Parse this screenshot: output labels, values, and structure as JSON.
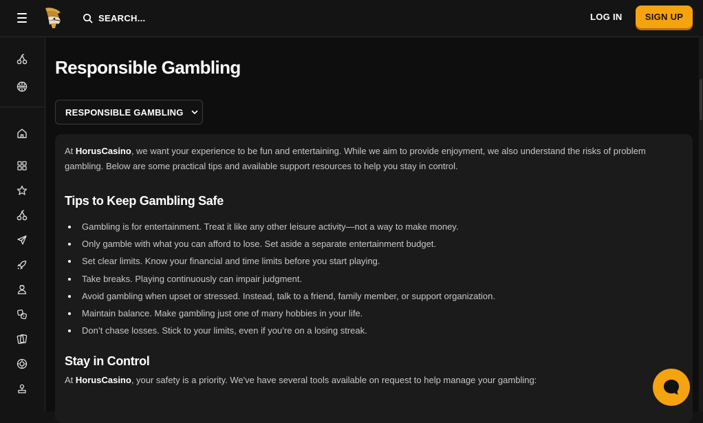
{
  "header": {
    "search_label": "SEARCH...",
    "login_label": "LOG IN",
    "signup_label": "SIGN UP",
    "accent_color": "#f5a30f"
  },
  "sidebar": {
    "icons": [
      "cherries-icon",
      "basketball-icon",
      "home-icon",
      "grid-icon",
      "star-icon",
      "cherries-icon",
      "plane-icon",
      "rocket-icon",
      "dealer-icon",
      "dice-icon",
      "cards-icon",
      "poker-chip-icon",
      "user-upload-icon"
    ]
  },
  "page": {
    "title": "Responsible Gambling",
    "dropdown_label": "RESPONSIBLE GAMBLING",
    "intro": {
      "prefix": "At ",
      "brand": "HorusCasino",
      "text": ", we want your experience to be fun and entertaining. While we aim to provide enjoyment, we also understand the risks of problem gambling. Below are some practical tips and available support resources to help you stay in control."
    },
    "tips_heading": "Tips to Keep Gambling Safe",
    "tips": [
      "Gambling is for entertainment. Treat it like any other leisure activity—not a way to make money.",
      "Only gamble with what you can afford to lose. Set aside a separate entertainment budget.",
      "Set clear limits. Know your financial and time limits before you start playing.",
      "Take breaks. Playing continuously can impair judgment.",
      "Avoid gambling when upset or stressed. Instead, talk to a friend, family member, or support organization.",
      "Maintain balance. Make gambling just one of many hobbies in your life.",
      "Don’t chase losses. Stick to your limits, even if you’re on a losing streak."
    ],
    "control_heading": "Stay in Control",
    "control": {
      "prefix": "At ",
      "brand": "HorusCasino",
      "text": ", your safety is a priority. We've have several tools available on request to help manage your gambling:"
    }
  }
}
